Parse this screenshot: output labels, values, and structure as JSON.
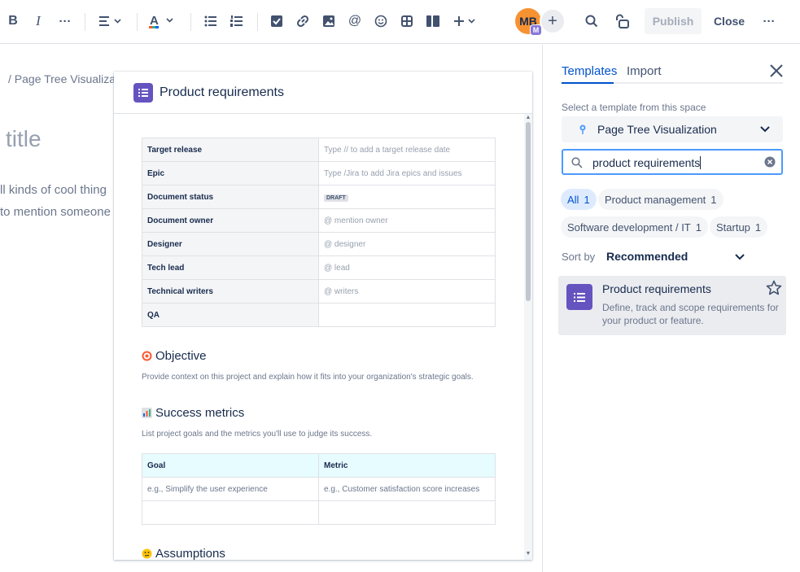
{
  "toolbar": {
    "avatar_initials": "MB",
    "avatar_badge": "M",
    "publish_label": "Publish",
    "close_label": "Close"
  },
  "editor": {
    "breadcrumb": "/  Page Tree Visualiza",
    "title_placeholder": "title",
    "line1": "ll kinds of cool thing",
    "line2": "to mention someone"
  },
  "preview": {
    "title": "Product requirements",
    "table": [
      {
        "key": "Target release",
        "value": "Type // to add a target release date"
      },
      {
        "key": "Epic",
        "value": "Type /Jira to add Jira epics and issues"
      },
      {
        "key": "Document status",
        "value": "DRAFT"
      },
      {
        "key": "Document owner",
        "value": "@ mention owner"
      },
      {
        "key": "Designer",
        "value": "@ designer"
      },
      {
        "key": "Tech lead",
        "value": "@ lead"
      },
      {
        "key": "Technical writers",
        "value": "@ writers"
      },
      {
        "key": "QA",
        "value": ""
      }
    ],
    "objective": {
      "heading": "Objective",
      "text": "Provide context on this project and explain how it fits into your organization's strategic goals."
    },
    "success": {
      "heading": "Success metrics",
      "text": "List project goals and the metrics you'll use to judge its success.",
      "col1": "Goal",
      "col2": "Metric",
      "row1_goal": "e.g., Simplify the user experience",
      "row1_metric": "e.g., Customer satisfaction score increases"
    },
    "assumptions_heading": "Assumptions"
  },
  "panel": {
    "tab_templates": "Templates",
    "tab_import": "Import",
    "select_label": "Select a template from this space",
    "space_name": "Page Tree Visualization",
    "search_value": "product requirements",
    "chips": [
      {
        "label": "All",
        "count": "1"
      },
      {
        "label": "Product management",
        "count": "1"
      },
      {
        "label": "Software development / IT",
        "count": "1"
      },
      {
        "label": "Startup",
        "count": "1"
      }
    ],
    "sort_label": "Sort by",
    "sort_value": "Recommended",
    "result": {
      "title": "Product requirements",
      "description": "Define, track and scope requirements for your product or feature."
    }
  },
  "colors": {
    "accent": "#0052cc",
    "template_icon": "#6554c0",
    "avatar": "#f79232"
  }
}
